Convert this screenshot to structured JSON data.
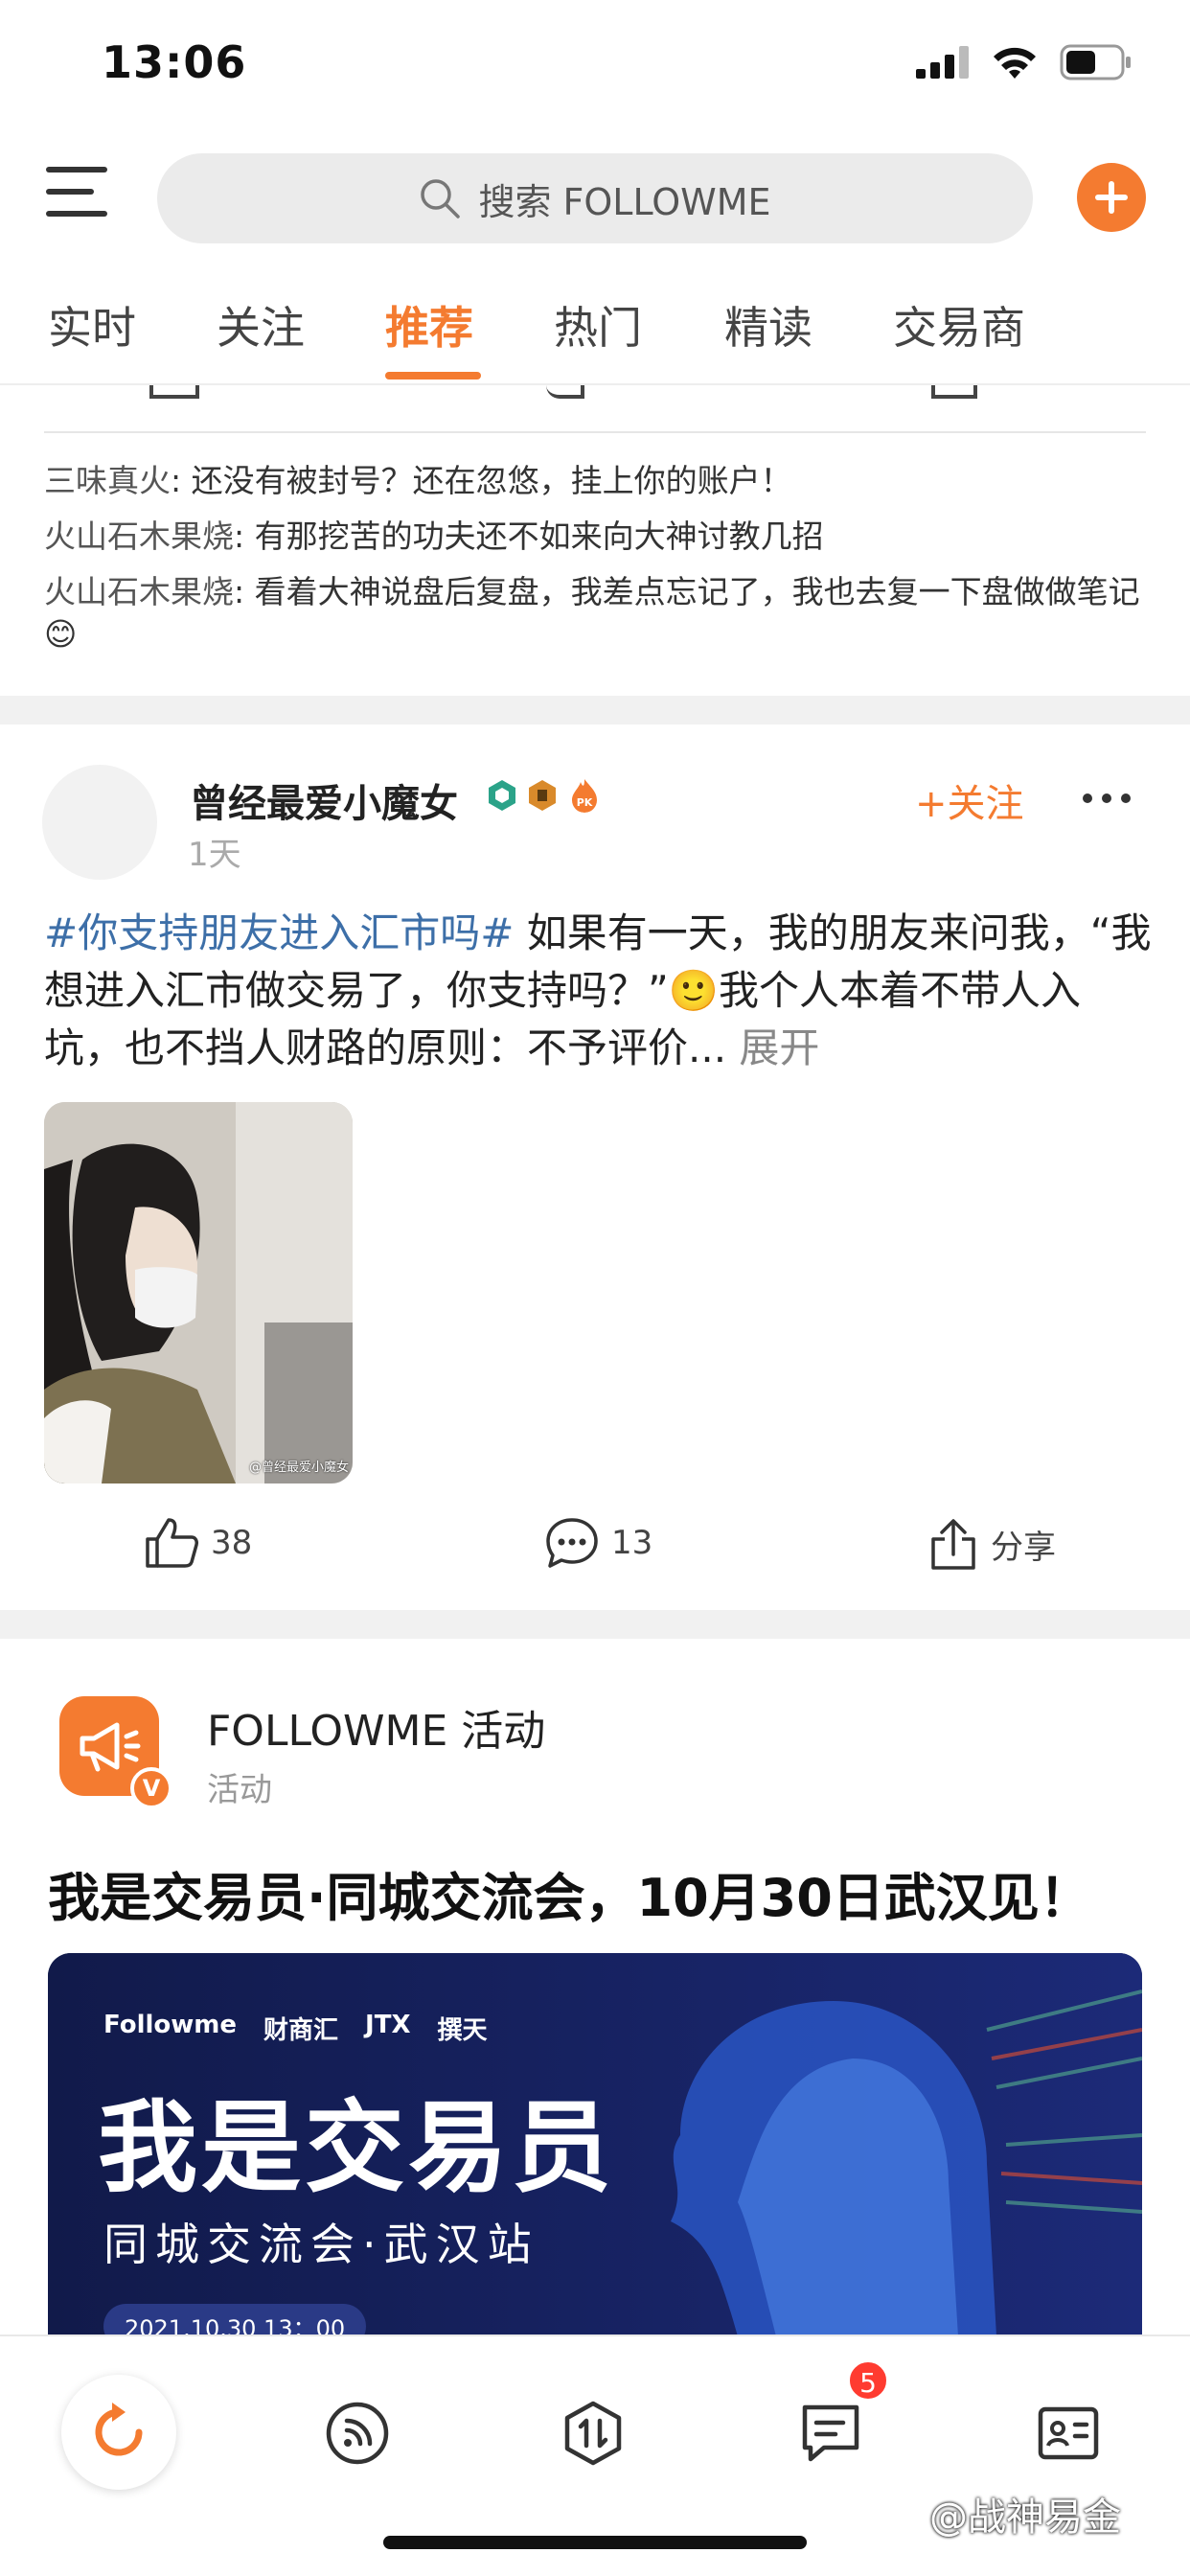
{
  "status_bar": {
    "time": "13:06"
  },
  "header": {
    "search_placeholder": "搜索 FOLLOWME"
  },
  "tabs": [
    {
      "label": "实时"
    },
    {
      "label": "关注"
    },
    {
      "label": "推荐"
    },
    {
      "label": "热门"
    },
    {
      "label": "精读"
    },
    {
      "label": "交易商"
    }
  ],
  "active_tab": "推荐",
  "comments": [
    {
      "author": "三味真火",
      "text": ": 还没有被封号？还在忽悠，挂上你的账户！"
    },
    {
      "author": "火山石木果烧",
      "text": ": 有那挖苦的功夫还不如来向大神讨教几招"
    },
    {
      "author": "火山石木果烧",
      "text": ": 看着大神说盘后复盘，我差点忘记了，我也去复一下盘做做笔记😊"
    }
  ],
  "post": {
    "author": "曾经最爱小魔女",
    "time": "1天",
    "follow_label": "+关注",
    "hashtag": "#你支持朋友进入汇市吗#",
    "body": " 如果有一天，我的朋友来问我，“我想进入汇市做交易了，你支持吗？”🙂我个人本着不带人入坑，也不挡人财路的原则：不予评价...",
    "expand_label": "展开",
    "image_watermark": "@曾经最爱小魔女",
    "likes": "38",
    "comments": "13",
    "share_label": "分享"
  },
  "activity": {
    "name": "FOLLOWME 活动",
    "subtitle": "活动",
    "verified_mark": "V",
    "title": "我是交易员·同城交流会，10月30日武汉见！",
    "banner": {
      "sponsors": [
        "Followme",
        "财商汇",
        "JTX",
        "撰天"
      ],
      "main_text": "我是交易员",
      "sub_text": "同城交流会·武汉站",
      "date": "2021.10.30 13：00"
    }
  },
  "bottom_nav": {
    "items": [
      {
        "icon": "refresh-icon"
      },
      {
        "icon": "feed-icon"
      },
      {
        "icon": "trade-icon"
      },
      {
        "icon": "message-icon"
      },
      {
        "icon": "profile-card-icon"
      }
    ],
    "message_badge": "5"
  },
  "watermark": "@战神易金",
  "colors": {
    "accent": "#f47b30",
    "hashtag": "#3d6fa8",
    "badge": "#ff3b30"
  }
}
